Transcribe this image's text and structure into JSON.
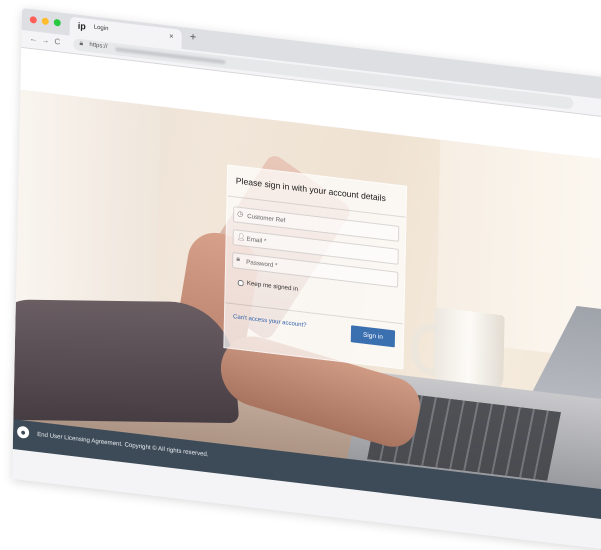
{
  "browser": {
    "tab_title": "Login",
    "tab_favicon": "ip",
    "new_tab_label": "+",
    "close_tab_label": "×",
    "url_text": "https://"
  },
  "login": {
    "heading": "Please sign in with your account details",
    "customer_ref_placeholder": "Customer Ref",
    "email_placeholder": "Email *",
    "password_placeholder": "Password *",
    "keep_signed_in_label": "Keep me signed in",
    "forgot_link": "Can't access your account?",
    "signin_button": "Sign in"
  },
  "footer": {
    "text": "End User Licensing Agreement. Copyright © All rights reserved."
  },
  "icons": {
    "back": "back-arrow-icon",
    "forward": "forward-arrow-icon",
    "reload": "reload-icon",
    "lock": "lock-icon",
    "customer": "clock-icon",
    "user": "user-icon",
    "password": "padlock-icon",
    "footer": "user-circle-icon"
  },
  "colors": {
    "traffic_red": "#ff5f57",
    "traffic_yellow": "#febc2e",
    "traffic_green": "#28c840",
    "accent": "#3a6fb0",
    "footer_bg": "#3d4b58"
  }
}
